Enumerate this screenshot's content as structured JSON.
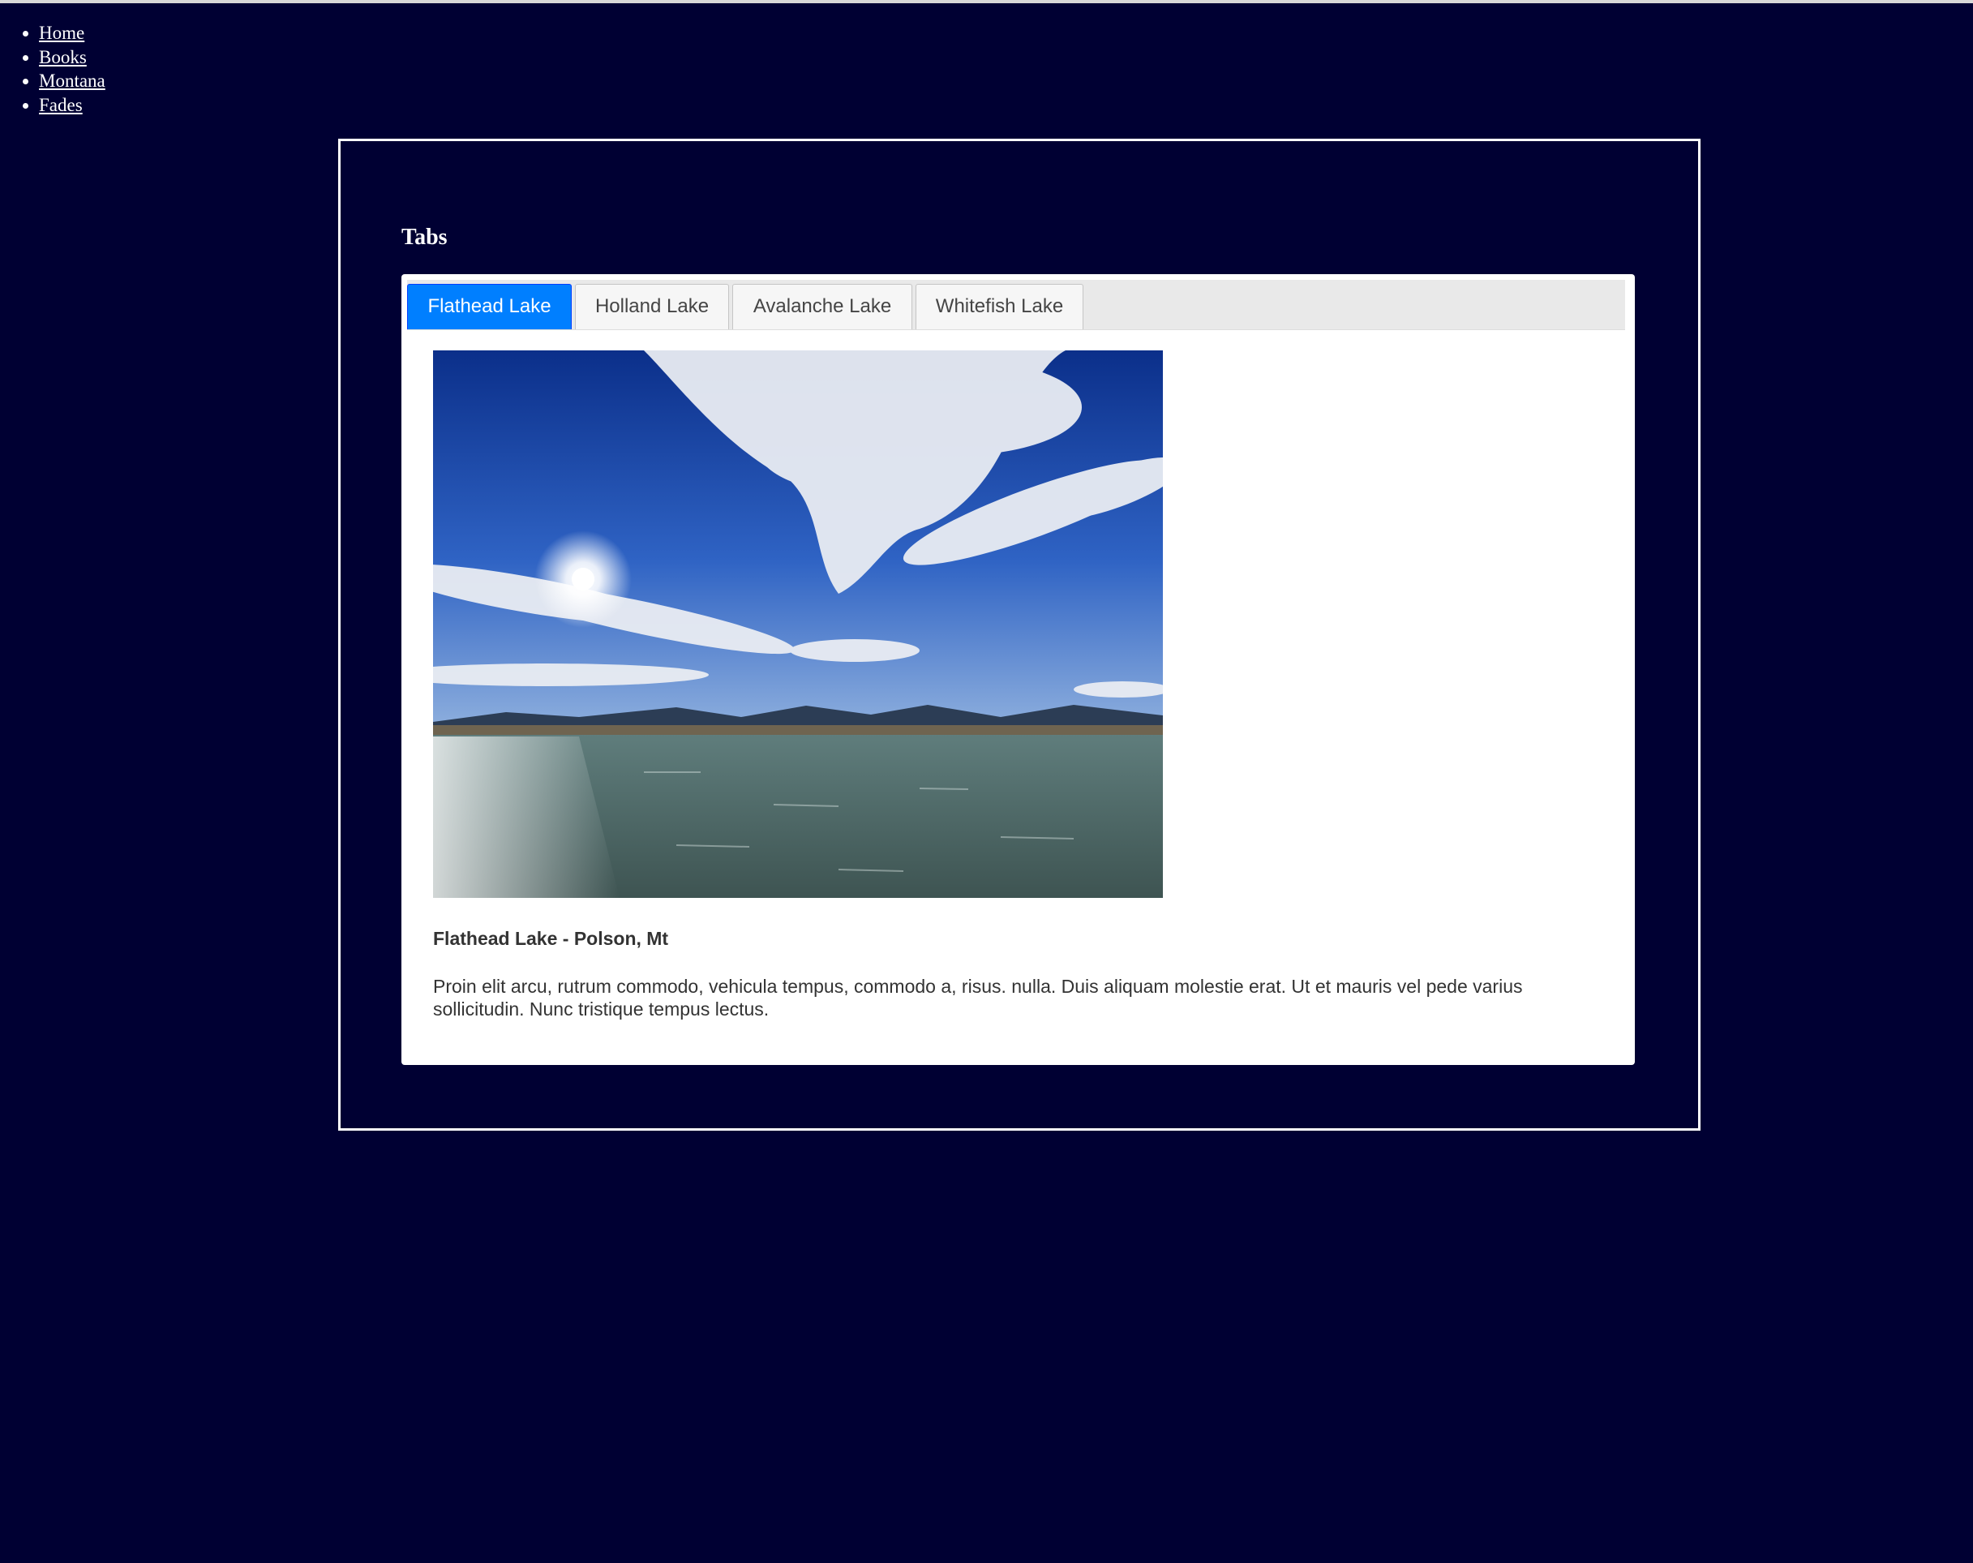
{
  "nav": {
    "items": [
      {
        "label": "Home"
      },
      {
        "label": "Books"
      },
      {
        "label": "Montana"
      },
      {
        "label": "Fades"
      }
    ]
  },
  "section": {
    "title": "Tabs"
  },
  "tabs": {
    "items": [
      {
        "label": "Flathead Lake",
        "active": true
      },
      {
        "label": "Holland Lake",
        "active": false
      },
      {
        "label": "Avalanche Lake",
        "active": false
      },
      {
        "label": "Whitefish Lake",
        "active": false
      }
    ],
    "active_color": "#007fff"
  },
  "panel": {
    "caption": "Flathead Lake - Polson, Mt",
    "body": "Proin elit arcu, rutrum commodo, vehicula tempus, commodo a, risus. nulla. Duis aliquam molestie erat. Ut et mauris vel pede varius sollicitudin. Nunc tristique tempus lectus."
  },
  "colors": {
    "page_background": "#000033",
    "frame_border": "#ffffff"
  }
}
